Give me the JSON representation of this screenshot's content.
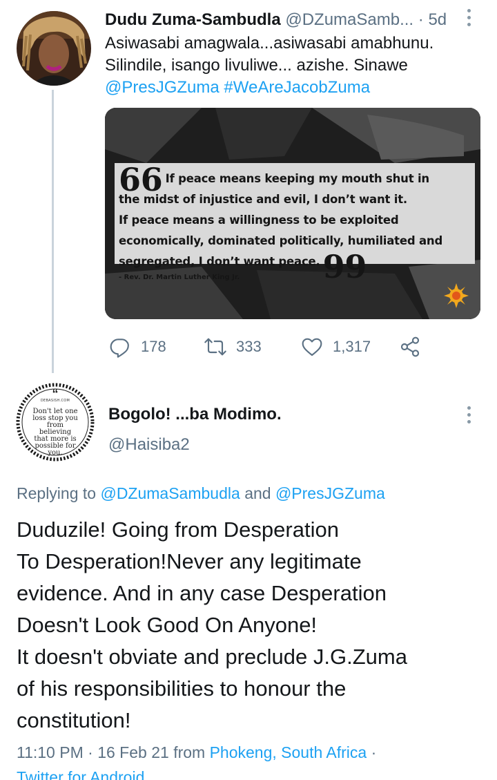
{
  "parent_tweet": {
    "name": "Dudu Zuma-Sambudla",
    "handle": "@DZumaSamb...",
    "separator": "·",
    "time": "5d",
    "text_lines": [
      "Asiwasabi amagwala...asiwasabi amabhunu.",
      "Silindile, isango livuliwe... azishe. Sinawe"
    ],
    "mentions": [
      "@PresJGZuma",
      "#WeAreJacobZuma"
    ],
    "image": {
      "quote_lines": [
        "If peace means keeping my mouth shut in",
        "the midst of injustice and evil, I don’t want it.",
        "If peace means a willingness to be exploited",
        "economically, dominated politically, humiliated and",
        "segregated, I don’t want peace."
      ],
      "open_quote_glyph": "66",
      "close_quote_glyph": "99",
      "attribution": "- Rev. Dr. Martin Luther King Jr."
    },
    "actions": {
      "replies": "178",
      "retweets": "333",
      "likes": "1,317"
    }
  },
  "main_tweet": {
    "name": "Bogolo! ...ba Modimo.",
    "handle": "@Haisiba2",
    "avatar": {
      "quote_glyph": "“",
      "brand": "DEBASISH.COM",
      "text_lines": [
        "Don't let one",
        "loss stop you",
        "from believing",
        "that more is",
        "possible for",
        "you."
      ]
    },
    "replying": {
      "prefix": "Replying to",
      "user1": "@DZumaSambudla",
      "conjunction": "and",
      "user2": "@PresJGZuma"
    },
    "text_lines": [
      "Duduzile! Going from Desperation",
      "To Desperation!Never any legitimate",
      "evidence. And in any case Desperation",
      "Doesn't Look Good On Anyone!",
      "It doesn't obviate and preclude J.G.Zuma",
      "of his responsibilities to  honour the",
      "constitution!"
    ],
    "meta": {
      "time": "11:10 PM",
      "sep1": "·",
      "date": "16 Feb 21",
      "from": "from",
      "location": "Phokeng, South Africa",
      "sep2": "·",
      "client": "Twitter for Android"
    }
  },
  "colors": {
    "link": "#1da1f2",
    "secondary_text": "#5b7083",
    "primary_text": "#14171a",
    "thread_line": "#c9d3db"
  },
  "icons": [
    "reply-icon",
    "retweet-icon",
    "like-icon",
    "share-icon",
    "more-options-icon"
  ]
}
